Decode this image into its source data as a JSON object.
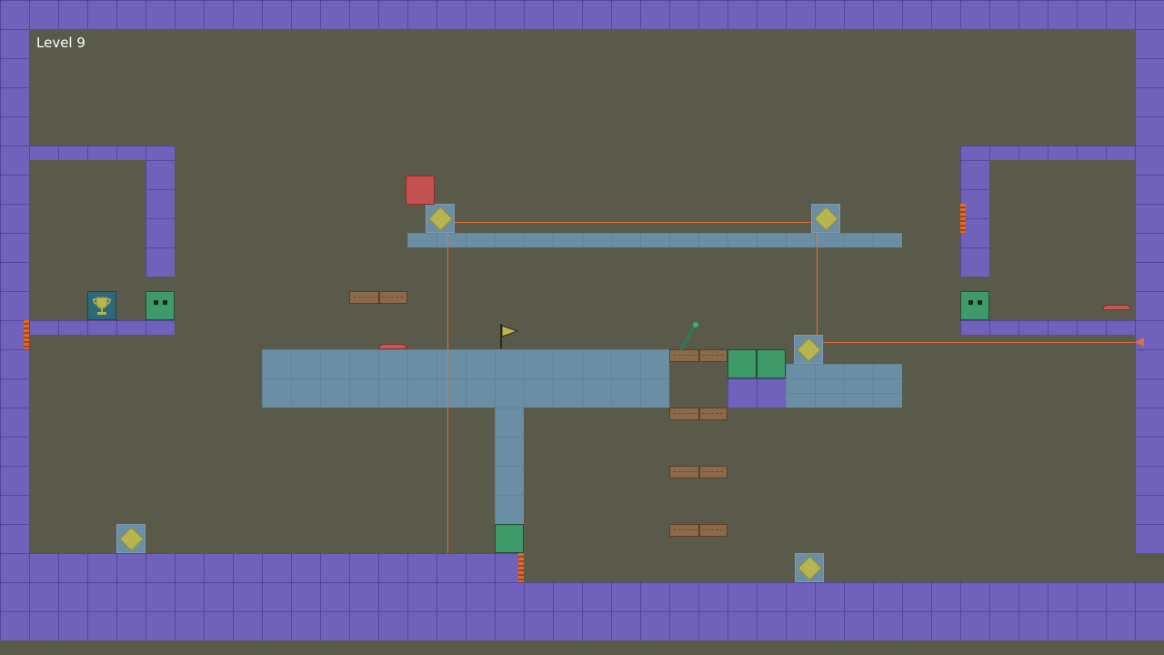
{
  "hud": {
    "level_label": "Level 9"
  },
  "colors": {
    "background": "#5a5a4a",
    "wall": "#7062ba",
    "water": "#6a8fa5",
    "green_block": "#3f9a6a",
    "red_block": "#c4514f",
    "laser": "#e0703a",
    "plank": "#8a6a4a"
  },
  "icons": {
    "goal": "trophy-icon",
    "checkpoint": "flag-icon",
    "switch": "lever-icon",
    "emitter": "laser-emitter-icon"
  }
}
